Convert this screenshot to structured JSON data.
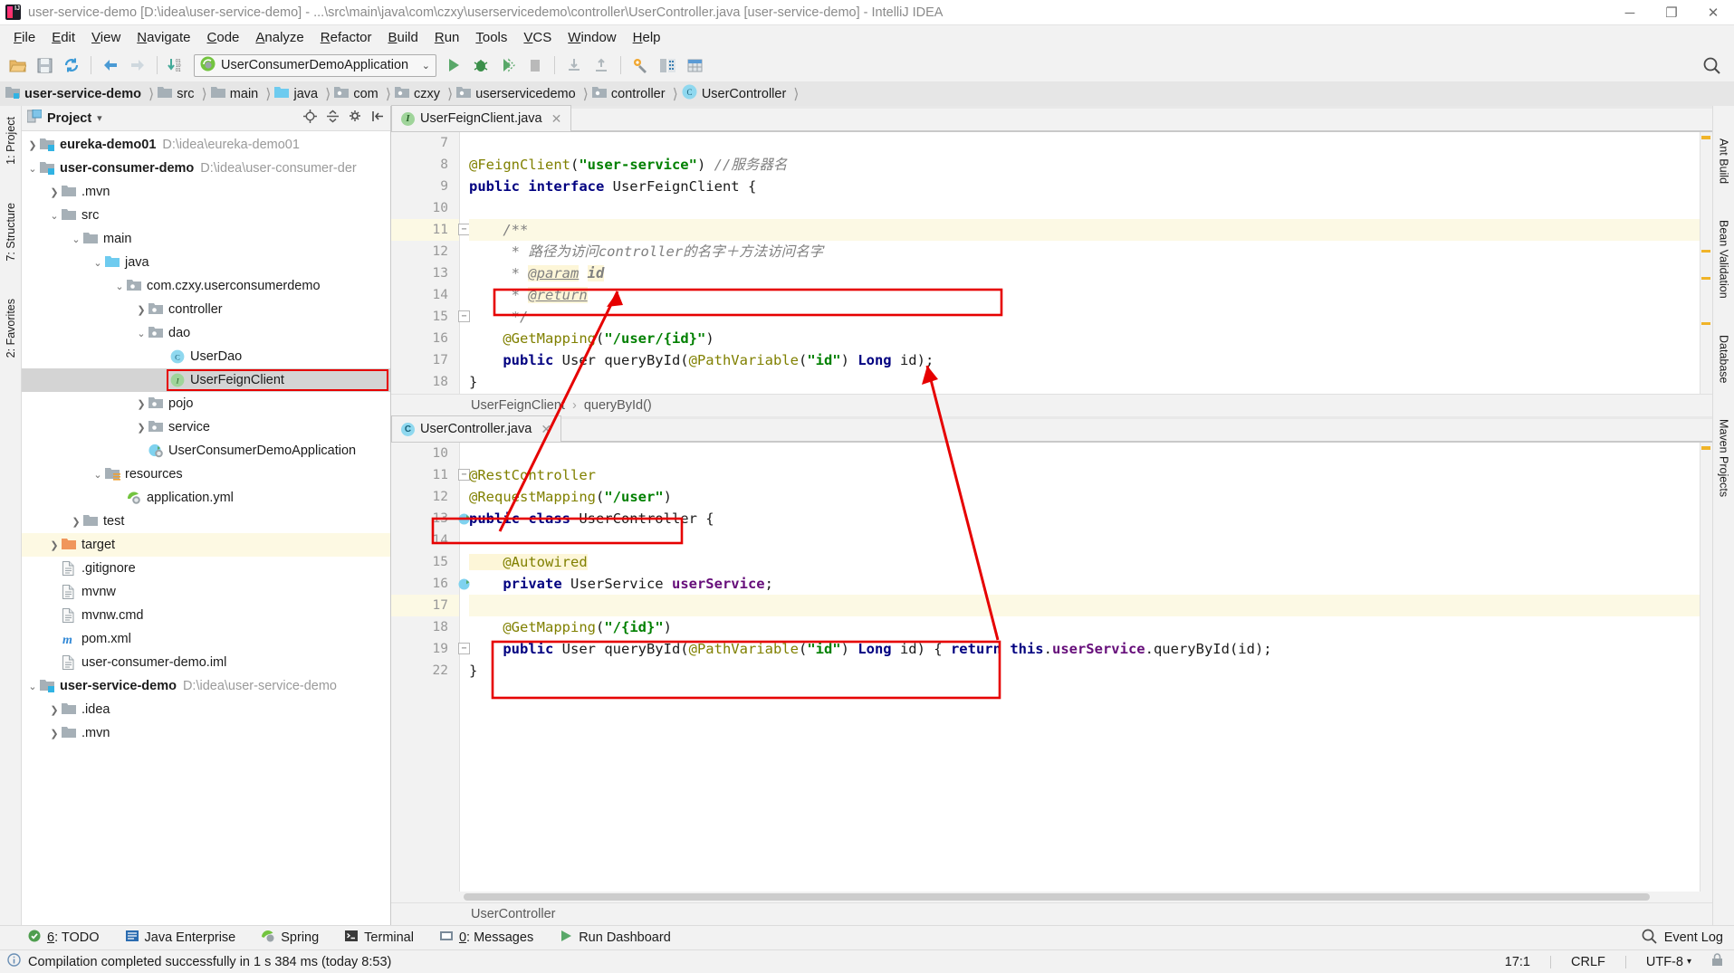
{
  "window": {
    "title": "user-service-demo [D:\\idea\\user-service-demo] - ...\\src\\main\\java\\com\\czxy\\userservicedemo\\controller\\UserController.java [user-service-demo] - IntelliJ IDEA",
    "minimize": "─",
    "maximize": "❐",
    "close": "✕"
  },
  "menu": [
    "File",
    "Edit",
    "View",
    "Navigate",
    "Code",
    "Analyze",
    "Refactor",
    "Build",
    "Run",
    "Tools",
    "VCS",
    "Window",
    "Help"
  ],
  "toolbar": {
    "run_config": "UserConsumerDemoApplication",
    "chevron": "⌄",
    "buttons": [
      {
        "name": "open-project-icon",
        "glyph": "▰"
      },
      {
        "name": "save-all-icon",
        "glyph": "▤"
      },
      {
        "name": "sync-icon",
        "glyph": "↻"
      },
      {
        "name": "back-icon",
        "glyph": "←"
      },
      {
        "name": "forward-icon",
        "glyph": "→"
      },
      {
        "name": "compile-icon",
        "glyph": "↓"
      },
      {
        "name": "run-icon",
        "glyph": "▶"
      },
      {
        "name": "debug-icon",
        "glyph": "⚙"
      },
      {
        "name": "run-coverage-icon",
        "glyph": "▒"
      },
      {
        "name": "stop-icon",
        "glyph": "■"
      },
      {
        "name": "update-project-icon",
        "glyph": "⇩"
      },
      {
        "name": "commit-icon",
        "glyph": "⇧"
      },
      {
        "name": "settings-icon",
        "glyph": "⚙"
      },
      {
        "name": "project-structure-icon",
        "glyph": "⊞"
      },
      {
        "name": "database-icon",
        "glyph": "⌸"
      }
    ],
    "search_icon": "⚲"
  },
  "breadcrumb": [
    {
      "label": "user-service-demo",
      "icon": "module-folder",
      "bold": true
    },
    {
      "label": "src",
      "icon": "folder",
      "bold": false
    },
    {
      "label": "main",
      "icon": "folder",
      "bold": false
    },
    {
      "label": "java",
      "icon": "source-folder",
      "bold": false
    },
    {
      "label": "com",
      "icon": "package",
      "bold": false
    },
    {
      "label": "czxy",
      "icon": "package",
      "bold": false
    },
    {
      "label": "userservicedemo",
      "icon": "package",
      "bold": false
    },
    {
      "label": "controller",
      "icon": "package",
      "bold": false
    },
    {
      "label": "UserController",
      "icon": "class",
      "bold": false
    }
  ],
  "left_strip": [
    "1: Project",
    "7: Structure",
    "2: Favorites"
  ],
  "right_strip": [
    "Ant Build",
    "Bean Validation",
    "Database",
    "Maven Projects"
  ],
  "project_panel": {
    "title": "Project",
    "title_chevron": "▾",
    "icons": {
      "locate": "⊕",
      "collapse": "≣",
      "settings": "⚙",
      "hide": "⇤"
    },
    "tree": [
      {
        "indent": 0,
        "twist": "❯",
        "icon": "module",
        "label": "eureka-demo01",
        "bold": true,
        "path": "D:\\idea\\eureka-demo01",
        "state": "none"
      },
      {
        "indent": 0,
        "twist": "⌄",
        "icon": "module",
        "label": "user-consumer-demo",
        "bold": true,
        "path": "D:\\idea\\user-consumer-der",
        "state": "none"
      },
      {
        "indent": 1,
        "twist": "❯",
        "icon": "folder",
        "label": ".mvn",
        "bold": false,
        "path": "",
        "state": "none"
      },
      {
        "indent": 1,
        "twist": "⌄",
        "icon": "folder",
        "label": "src",
        "bold": false,
        "path": "",
        "state": "none"
      },
      {
        "indent": 2,
        "twist": "⌄",
        "icon": "folder",
        "label": "main",
        "bold": false,
        "path": "",
        "state": "none"
      },
      {
        "indent": 3,
        "twist": "⌄",
        "icon": "source-folder",
        "label": "java",
        "bold": false,
        "path": "",
        "state": "none"
      },
      {
        "indent": 4,
        "twist": "⌄",
        "icon": "package",
        "label": "com.czxy.userconsumerdemo",
        "bold": false,
        "path": "",
        "state": "none"
      },
      {
        "indent": 5,
        "twist": "❯",
        "icon": "package",
        "label": "controller",
        "bold": false,
        "path": "",
        "state": "none"
      },
      {
        "indent": 5,
        "twist": "⌄",
        "icon": "package",
        "label": "dao",
        "bold": false,
        "path": "",
        "state": "none"
      },
      {
        "indent": 6,
        "twist": "",
        "icon": "class",
        "label": "UserDao",
        "bold": false,
        "path": "",
        "state": "none"
      },
      {
        "indent": 6,
        "twist": "",
        "icon": "interface",
        "label": "UserFeignClient",
        "bold": false,
        "path": "",
        "state": "selected-redbox"
      },
      {
        "indent": 5,
        "twist": "❯",
        "icon": "package",
        "label": "pojo",
        "bold": false,
        "path": "",
        "state": "none"
      },
      {
        "indent": 5,
        "twist": "❯",
        "icon": "package",
        "label": "service",
        "bold": false,
        "path": "",
        "state": "none"
      },
      {
        "indent": 5,
        "twist": "",
        "icon": "spring-app",
        "label": "UserConsumerDemoApplication",
        "bold": false,
        "path": "",
        "state": "none"
      },
      {
        "indent": 3,
        "twist": "⌄",
        "icon": "resources-folder",
        "label": "resources",
        "bold": false,
        "path": "",
        "state": "none"
      },
      {
        "indent": 4,
        "twist": "",
        "icon": "spring-yml",
        "label": "application.yml",
        "bold": false,
        "path": "",
        "state": "none"
      },
      {
        "indent": 2,
        "twist": "❯",
        "icon": "folder",
        "label": "test",
        "bold": false,
        "path": "",
        "state": "none"
      },
      {
        "indent": 1,
        "twist": "❯",
        "icon": "folder-orange",
        "label": "target",
        "bold": false,
        "path": "",
        "state": "yellow"
      },
      {
        "indent": 1,
        "twist": "",
        "icon": "file",
        "label": ".gitignore",
        "bold": false,
        "path": "",
        "state": "none"
      },
      {
        "indent": 1,
        "twist": "",
        "icon": "file",
        "label": "mvnw",
        "bold": false,
        "path": "",
        "state": "none"
      },
      {
        "indent": 1,
        "twist": "",
        "icon": "file",
        "label": "mvnw.cmd",
        "bold": false,
        "path": "",
        "state": "none"
      },
      {
        "indent": 1,
        "twist": "",
        "icon": "maven",
        "label": "pom.xml",
        "bold": false,
        "path": "",
        "state": "none"
      },
      {
        "indent": 1,
        "twist": "",
        "icon": "file",
        "label": "user-consumer-demo.iml",
        "bold": false,
        "path": "",
        "state": "none"
      },
      {
        "indent": 0,
        "twist": "⌄",
        "icon": "module",
        "label": "user-service-demo",
        "bold": true,
        "path": "D:\\idea\\user-service-demo",
        "state": "none"
      },
      {
        "indent": 1,
        "twist": "❯",
        "icon": "folder",
        "label": ".idea",
        "bold": false,
        "path": "",
        "state": "none"
      },
      {
        "indent": 1,
        "twist": "❯",
        "icon": "folder",
        "label": ".mvn",
        "bold": false,
        "path": "",
        "state": "none"
      }
    ]
  },
  "editor_top": {
    "tab": {
      "label": "UserFeignClient.java",
      "icon": "interface",
      "close": "✕"
    },
    "lines": [
      {
        "num": "7",
        "hl": false,
        "fold": "",
        "tokens": []
      },
      {
        "num": "8",
        "hl": false,
        "fold": "",
        "tokens": [
          {
            "t": "@FeignClient",
            "c": "ann"
          },
          {
            "t": "(",
            "c": "plain"
          },
          {
            "t": "\"user-service\"",
            "c": "str"
          },
          {
            "t": ")",
            "c": "plain"
          },
          {
            "t": " ",
            "c": "plain"
          },
          {
            "t": "//服务器名",
            "c": "cmt"
          }
        ]
      },
      {
        "num": "9",
        "hl": false,
        "fold": "",
        "tokens": [
          {
            "t": "public interface",
            "c": "k"
          },
          {
            "t": " UserFeignClient {",
            "c": "plain"
          }
        ]
      },
      {
        "num": "10",
        "hl": false,
        "fold": "",
        "tokens": []
      },
      {
        "num": "11",
        "hl": true,
        "fold": "minus",
        "tokens": [
          {
            "t": "    /**",
            "c": "jd"
          }
        ]
      },
      {
        "num": "12",
        "hl": false,
        "fold": "",
        "tokens": [
          {
            "t": "     * 路径为访问controller的名字＋方法访问名字",
            "c": "jd"
          }
        ]
      },
      {
        "num": "13",
        "hl": false,
        "fold": "",
        "tokens": [
          {
            "t": "     * ",
            "c": "jd"
          },
          {
            "t": "@param",
            "c": "jdtag"
          },
          {
            "t": " ",
            "c": "jd"
          },
          {
            "t": "id",
            "c": "jdtag-bold"
          }
        ]
      },
      {
        "num": "14",
        "hl": false,
        "fold": "",
        "tokens": [
          {
            "t": "     * ",
            "c": "jd"
          },
          {
            "t": "@return",
            "c": "jdtag"
          }
        ]
      },
      {
        "num": "15",
        "hl": false,
        "fold": "plus",
        "tokens": [
          {
            "t": "     */",
            "c": "jd"
          }
        ]
      },
      {
        "num": "16",
        "hl": false,
        "fold": "",
        "tokens": [
          {
            "t": "    @GetMapping",
            "c": "ann"
          },
          {
            "t": "(",
            "c": "plain"
          },
          {
            "t": "\"/user/{id}\"",
            "c": "str"
          },
          {
            "t": ")",
            "c": "plain"
          }
        ]
      },
      {
        "num": "17",
        "hl": false,
        "fold": "",
        "tokens": [
          {
            "t": "    ",
            "c": "plain"
          },
          {
            "t": "public",
            "c": "k"
          },
          {
            "t": " User queryById(",
            "c": "plain"
          },
          {
            "t": "@PathVariable",
            "c": "ann"
          },
          {
            "t": "(",
            "c": "plain"
          },
          {
            "t": "\"id\"",
            "c": "str"
          },
          {
            "t": ") ",
            "c": "plain"
          },
          {
            "t": "Long",
            "c": "k"
          },
          {
            "t": " id);",
            "c": "plain"
          }
        ]
      },
      {
        "num": "18",
        "hl": false,
        "fold": "",
        "tokens": [
          {
            "t": "}",
            "c": "plain"
          }
        ]
      }
    ],
    "breadcrumb": [
      "UserFeignClient",
      "queryById()"
    ],
    "breadcrumb_sep": "›"
  },
  "editor_bottom": {
    "tab": {
      "label": "UserController.java",
      "icon": "class",
      "close": "✕"
    },
    "lines": [
      {
        "num": "10",
        "hl": false,
        "fold": "",
        "gut": "",
        "tokens": []
      },
      {
        "num": "11",
        "hl": false,
        "fold": "minus",
        "gut": "",
        "tokens": [
          {
            "t": "@RestController",
            "c": "ann"
          }
        ]
      },
      {
        "num": "12",
        "hl": false,
        "fold": "",
        "gut": "",
        "tokens": [
          {
            "t": "@RequestMapping",
            "c": "ann"
          },
          {
            "t": "(",
            "c": "plain"
          },
          {
            "t": "\"/user\"",
            "c": "str"
          },
          {
            "t": ")",
            "c": "plain"
          }
        ]
      },
      {
        "num": "13",
        "hl": false,
        "fold": "",
        "gut": "bean",
        "tokens": [
          {
            "t": "public class",
            "c": "k"
          },
          {
            "t": " UserController {",
            "c": "plain"
          }
        ]
      },
      {
        "num": "14",
        "hl": false,
        "fold": "",
        "gut": "",
        "tokens": []
      },
      {
        "num": "15",
        "hl": false,
        "fold": "",
        "gut": "",
        "tokens": [
          {
            "t": "    @Autowired",
            "c": "ann-hl"
          }
        ]
      },
      {
        "num": "16",
        "hl": false,
        "fold": "",
        "gut": "autowire",
        "tokens": [
          {
            "t": "    ",
            "c": "plain"
          },
          {
            "t": "private",
            "c": "k"
          },
          {
            "t": " UserService ",
            "c": "plain"
          },
          {
            "t": "userService",
            "c": "fld"
          },
          {
            "t": ";",
            "c": "plain"
          }
        ]
      },
      {
        "num": "17",
        "hl": true,
        "fold": "",
        "gut": "",
        "tokens": []
      },
      {
        "num": "18",
        "hl": false,
        "fold": "",
        "gut": "",
        "tokens": [
          {
            "t": "    @GetMapping",
            "c": "ann"
          },
          {
            "t": "(",
            "c": "plain"
          },
          {
            "t": "\"/{id}\"",
            "c": "str"
          },
          {
            "t": ")",
            "c": "plain"
          }
        ]
      },
      {
        "num": "19",
        "hl": false,
        "fold": "plus",
        "gut": "",
        "tokens": [
          {
            "t": "    ",
            "c": "plain"
          },
          {
            "t": "public",
            "c": "k"
          },
          {
            "t": " User queryById(",
            "c": "plain"
          },
          {
            "t": "@PathVariable",
            "c": "ann"
          },
          {
            "t": "(",
            "c": "plain"
          },
          {
            "t": "\"id\"",
            "c": "str"
          },
          {
            "t": ") ",
            "c": "plain"
          },
          {
            "t": "Long",
            "c": "k"
          },
          {
            "t": " id) { ",
            "c": "plain"
          },
          {
            "t": "return",
            "c": "k"
          },
          {
            "t": " ",
            "c": "plain"
          },
          {
            "t": "this",
            "c": "k"
          },
          {
            "t": ".",
            "c": "plain"
          },
          {
            "t": "userService",
            "c": "fld"
          },
          {
            "t": ".queryById(id);",
            "c": "plain"
          }
        ]
      },
      {
        "num": "22",
        "hl": false,
        "fold": "",
        "gut": "",
        "tokens": [
          {
            "t": "}",
            "c": "plain"
          }
        ]
      }
    ],
    "breadcrumb": [
      "UserController"
    ]
  },
  "annotations": {
    "red_boxes": [
      "feign-querybyid-signature",
      "requestmapping-user",
      "controller-querybyid-block",
      "tree-userfeignclient"
    ],
    "arrows": 2
  },
  "bottom_bar": {
    "items": [
      {
        "label": "6: TODO",
        "icon": "todo-icon",
        "underline": "6"
      },
      {
        "label": "Java Enterprise",
        "icon": "java-enterprise-icon"
      },
      {
        "label": "Spring",
        "icon": "spring-icon"
      },
      {
        "label": "Terminal",
        "icon": "terminal-icon"
      },
      {
        "label": "0: Messages",
        "icon": "messages-icon",
        "underline": "0"
      },
      {
        "label": "Run Dashboard",
        "icon": "run-dashboard-icon"
      }
    ],
    "event_log": {
      "label": "Event Log",
      "icon": "event-log-icon"
    }
  },
  "status_bar": {
    "message": "Compilation completed successfully in 1 s 384 ms (today 8:53)",
    "icon": "info-icon",
    "caret": "17:1",
    "line_sep": "CRLF",
    "encoding": "UTF-8",
    "lock": "🔒",
    "branch_sep": "↕"
  }
}
